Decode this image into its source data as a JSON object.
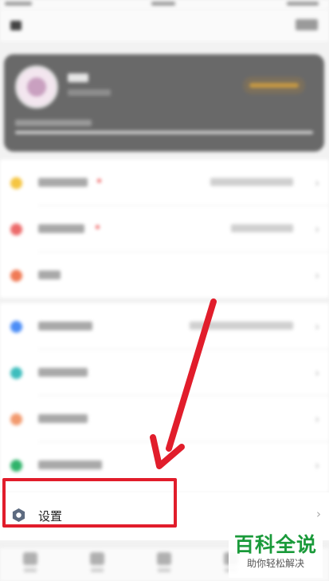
{
  "settings_row": {
    "label": "设置",
    "chevron": "›",
    "icon": "gear-icon"
  },
  "annotation": {
    "arrow_color": "#e11d2b",
    "highlight_color": "#e11d2b"
  },
  "watermark": {
    "title": "百科全说",
    "subtitle": "助你轻松解决"
  },
  "list_icons": {
    "group1": [
      "#f5c542",
      "#ec6b6b",
      "#f07a55"
    ],
    "group2": [
      "#4c8df6",
      "#3dbdbd",
      "#f29a6e",
      "#2fb36a"
    ]
  },
  "chevron": "›"
}
